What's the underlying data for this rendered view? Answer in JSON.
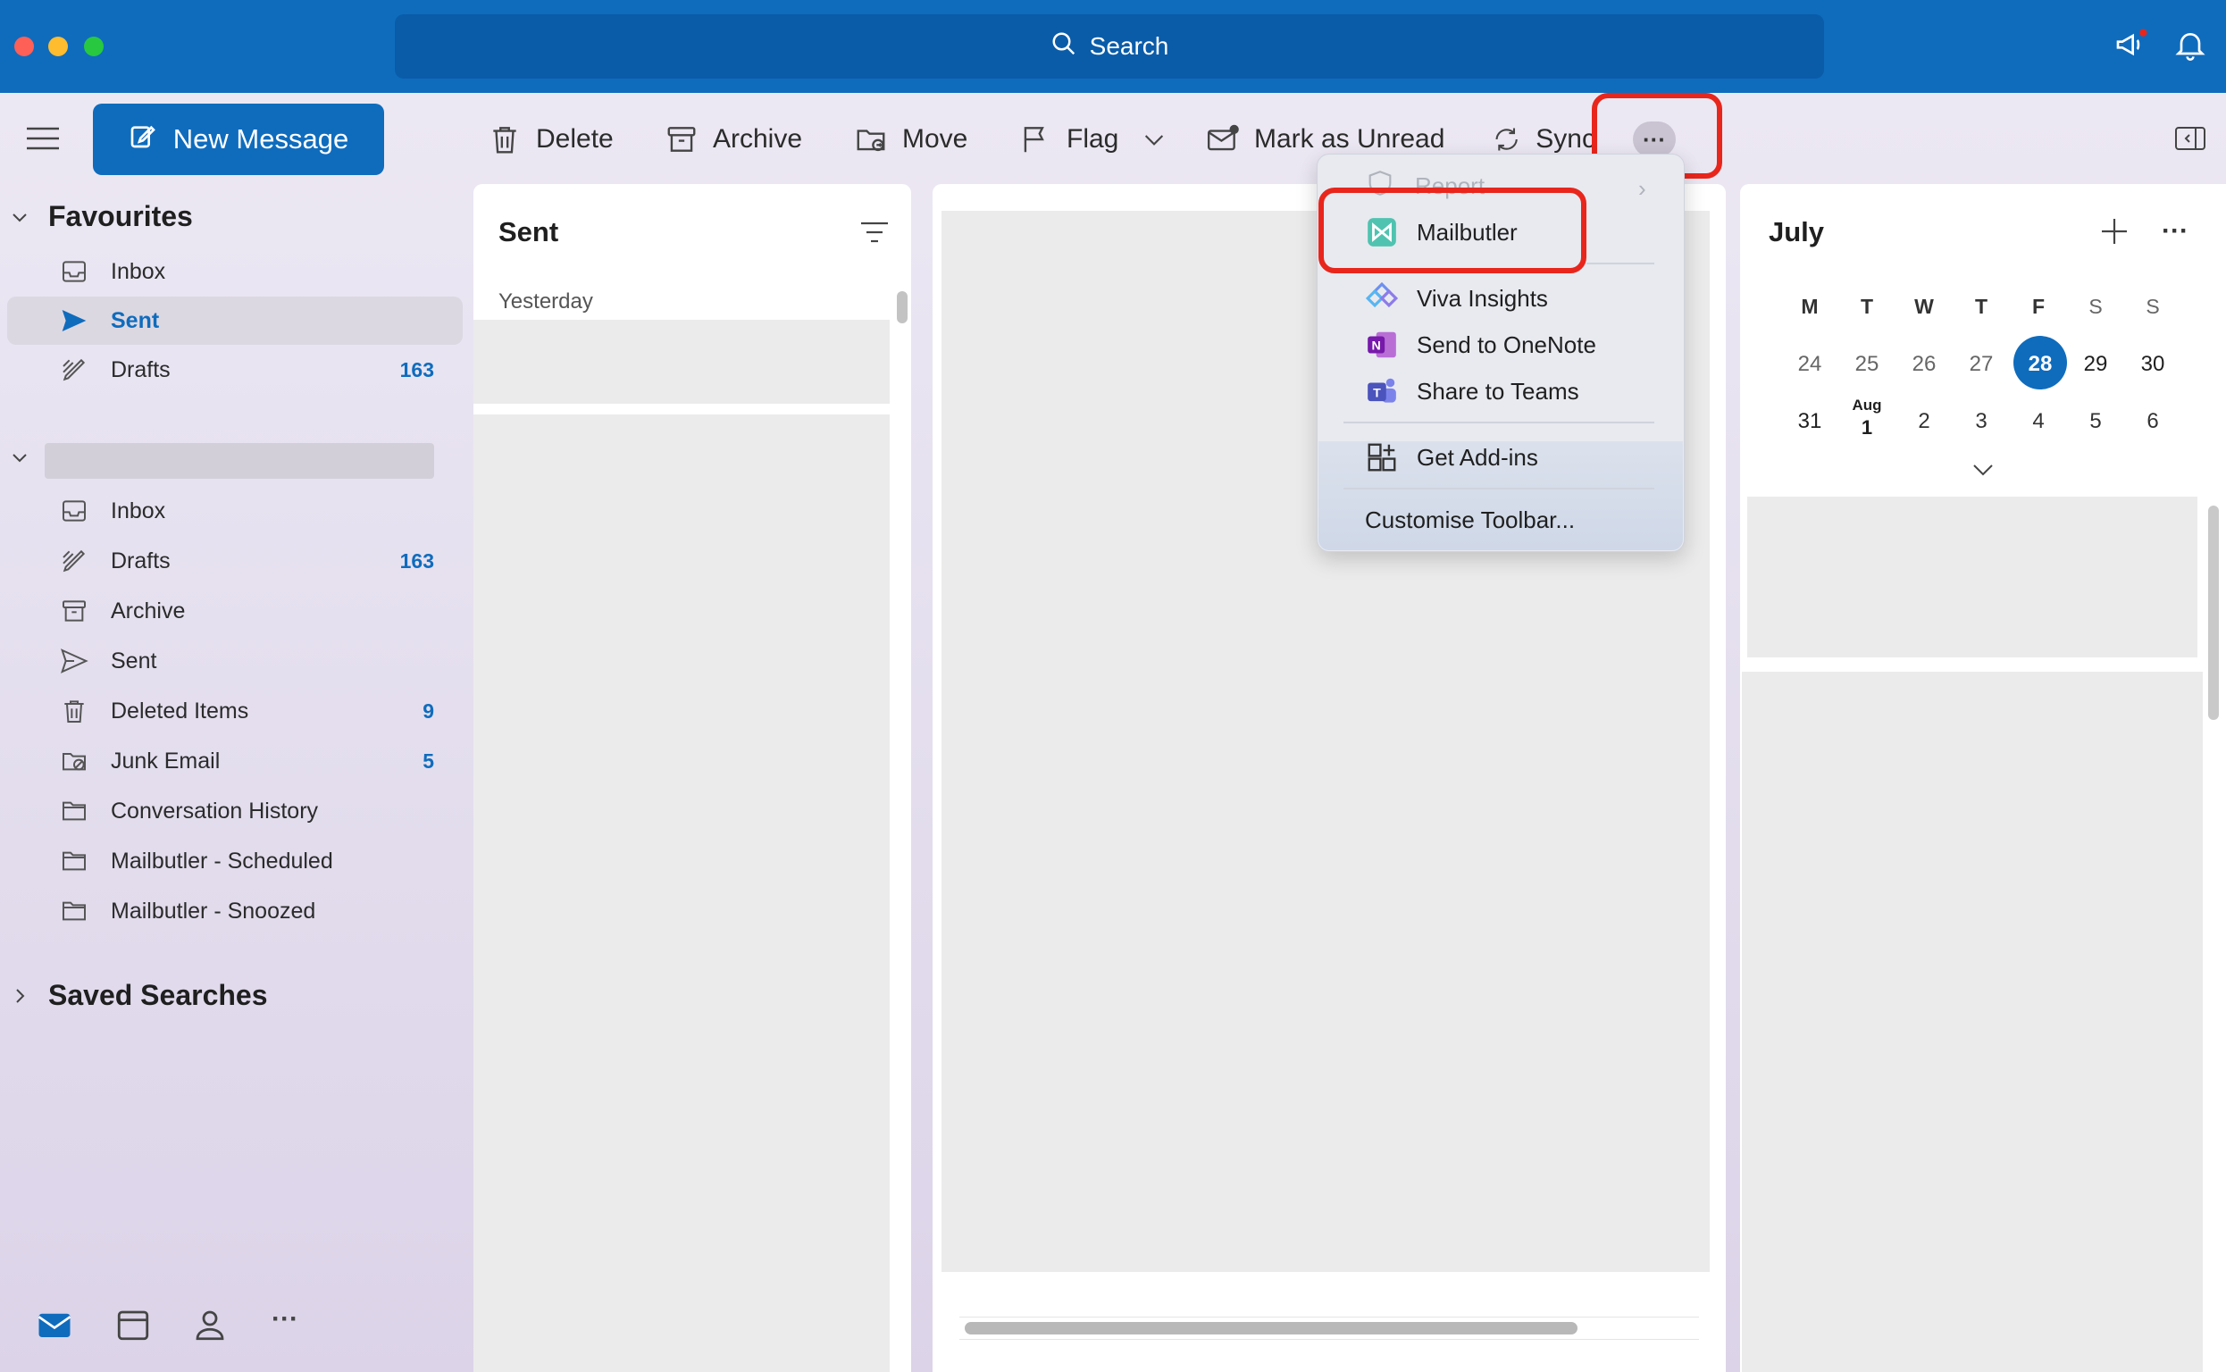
{
  "search": {
    "label": "Search"
  },
  "toolbar": {
    "new_message": "New Message",
    "delete": "Delete",
    "archive": "Archive",
    "move": "Move",
    "flag": "Flag",
    "mark_unread": "Mark as Unread",
    "sync": "Sync",
    "more": "···"
  },
  "sidebar": {
    "favourites_title": "Favourites",
    "favourites": [
      {
        "label": "Inbox",
        "icon": "inbox-icon",
        "count": ""
      },
      {
        "label": "Sent",
        "icon": "sent-icon",
        "count": ""
      },
      {
        "label": "Drafts",
        "icon": "drafts-icon",
        "count": "163"
      }
    ],
    "account_folders": [
      {
        "label": "Inbox",
        "icon": "inbox-icon",
        "count": ""
      },
      {
        "label": "Drafts",
        "icon": "drafts-icon",
        "count": "163"
      },
      {
        "label": "Archive",
        "icon": "archive-icon",
        "count": ""
      },
      {
        "label": "Sent",
        "icon": "sent-icon",
        "count": ""
      },
      {
        "label": "Deleted Items",
        "icon": "trash-icon",
        "count": "9"
      },
      {
        "label": "Junk Email",
        "icon": "junk-icon",
        "count": "5"
      },
      {
        "label": "Conversation History",
        "icon": "folder-icon",
        "count": ""
      },
      {
        "label": "Mailbutler - Scheduled",
        "icon": "folder-icon",
        "count": ""
      },
      {
        "label": "Mailbutler - Snoozed",
        "icon": "folder-icon",
        "count": ""
      }
    ],
    "saved_searches_title": "Saved Searches",
    "bottom_nav": [
      "mail-icon",
      "calendar-icon",
      "people-icon",
      "more-icon"
    ]
  },
  "list": {
    "title": "Sent",
    "group_label": "Yesterday"
  },
  "menu": {
    "report": "Report",
    "items": [
      {
        "label": "Mailbutler",
        "icon": "mailbutler-icon"
      },
      {
        "label": "Viva Insights",
        "icon": "viva-insights-icon"
      },
      {
        "label": "Send to OneNote",
        "icon": "onenote-icon"
      },
      {
        "label": "Share to Teams",
        "icon": "teams-icon"
      },
      {
        "label": "Get Add-ins",
        "icon": "add-ins-icon"
      },
      {
        "label": "Customise Toolbar...",
        "icon": ""
      }
    ]
  },
  "calendar": {
    "month": "July",
    "weekdays": [
      "M",
      "T",
      "W",
      "T",
      "F",
      "S",
      "S"
    ],
    "week1": [
      "24",
      "25",
      "26",
      "27",
      "28",
      "29",
      "30"
    ],
    "week2": [
      "31",
      "Aug\n1",
      "2",
      "3",
      "4",
      "5",
      "6"
    ],
    "aug_label": "Aug",
    "today": "28"
  },
  "colors": {
    "accent": "#0f6cbd",
    "highlight": "#e8261c"
  }
}
